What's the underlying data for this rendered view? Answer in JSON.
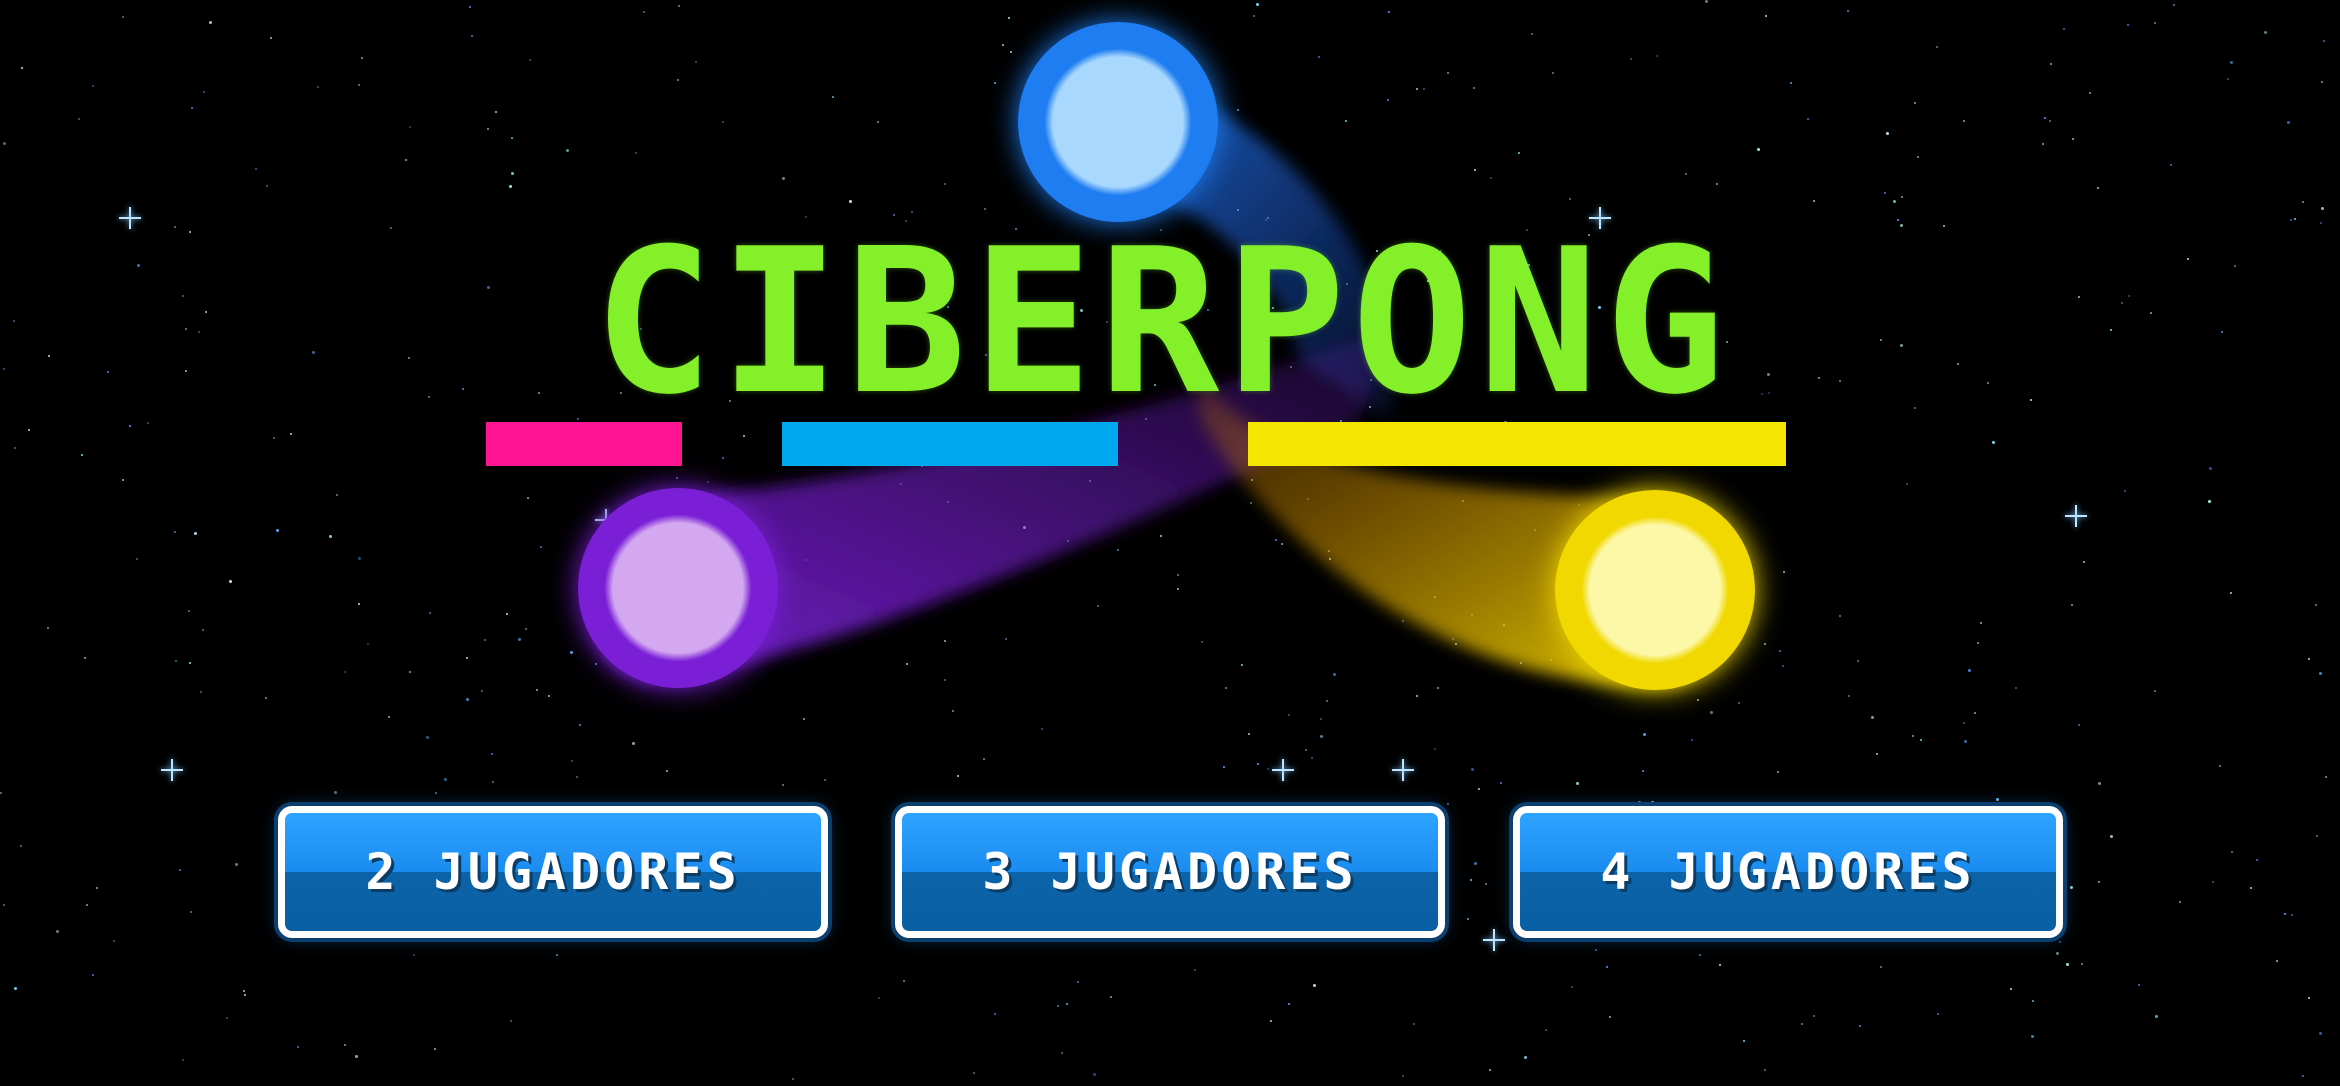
{
  "game": {
    "title": "CIBERPONG"
  },
  "menu": {
    "buttons": [
      {
        "label": "2 JUGADORES"
      },
      {
        "label": "3 JUGADORES"
      },
      {
        "label": "4 JUGADORES"
      }
    ]
  },
  "colors": {
    "background": "#000000",
    "title": "#84f02a",
    "bar_pink": "#ff1493",
    "bar_blue": "#00a8f0",
    "bar_yellow": "#f5e600",
    "ball_blue": "#1e7df0",
    "ball_purple": "#7a1fd6",
    "ball_yellow": "#f0d800",
    "button_fill": "#1a8cf0",
    "button_border": "#ffffff"
  },
  "icons": [
    "sparkle-star-icon",
    "ball-blue-icon",
    "ball-purple-icon",
    "ball-yellow-icon"
  ]
}
